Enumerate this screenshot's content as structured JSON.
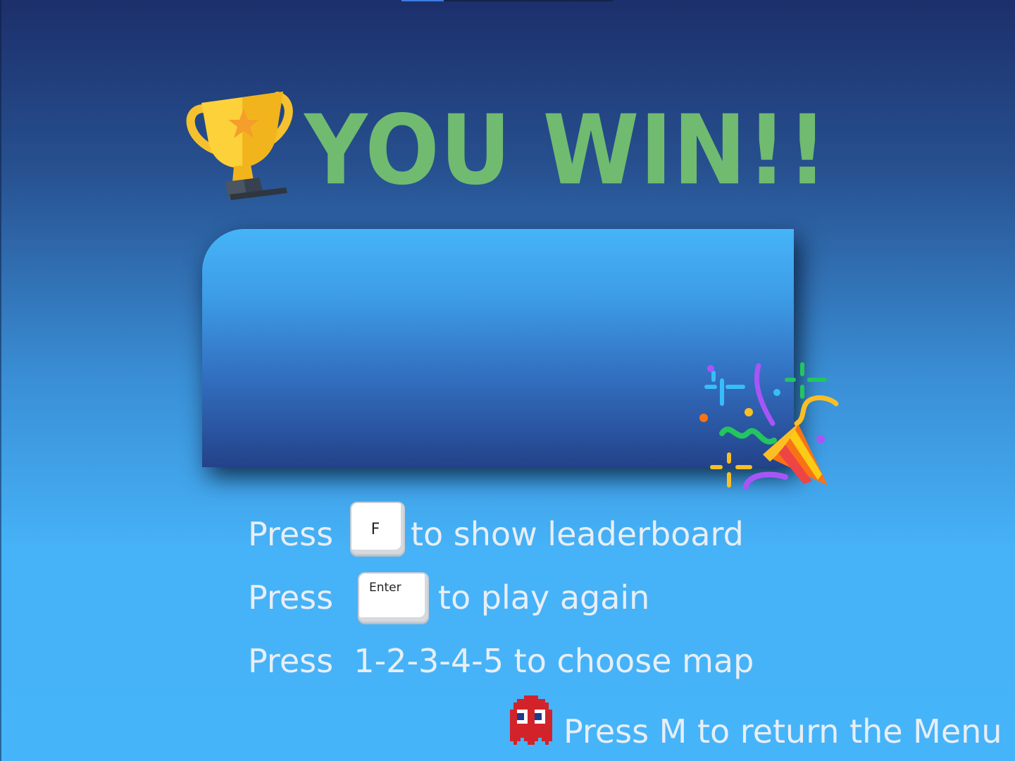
{
  "title": "YOU WIN!!",
  "instructions": {
    "leaderboard": {
      "prefix": "Press",
      "key": "F",
      "suffix": "to show leaderboard"
    },
    "play_again": {
      "prefix": "Press",
      "key": "Enter",
      "suffix": "to play again"
    },
    "choose_map": {
      "text": "Press  1-2-3-4-5 to choose map"
    },
    "menu": {
      "text": "Press M to return the Menu"
    }
  },
  "icons": {
    "trophy": "trophy-icon",
    "party": "party-popper-icon",
    "ghost": "red-ghost-icon"
  },
  "colors": {
    "title": "#70bb70",
    "text": "#e8eef6",
    "ghost": "#d2232a"
  }
}
